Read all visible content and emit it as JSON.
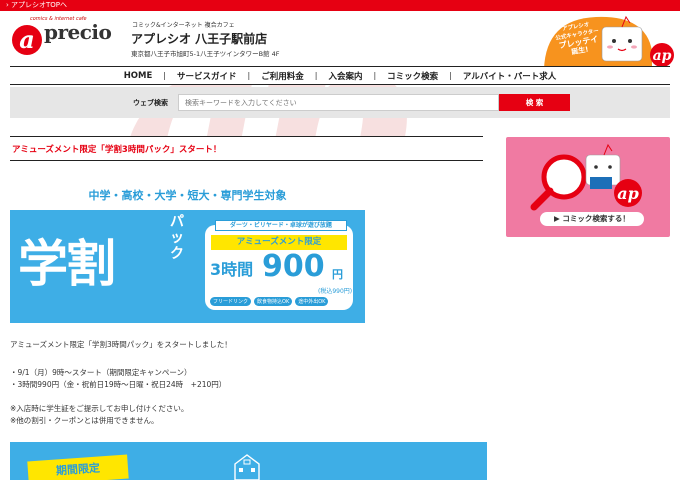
{
  "topbar": {
    "label": "› アプレシオTOPへ"
  },
  "header": {
    "logo_tagline": "comics & internet cafe",
    "logo_word": "precio",
    "store_tag": "コミック&インターネット 複合カフェ",
    "store_name": "アプレシオ 八王子駅前店",
    "store_address": "東京都八王子市旭町5-1八王子ツインタワーB館 4F",
    "mascot_caption": [
      "アプレシオ",
      "公式キャラクター",
      "プレッテイ",
      "誕生!"
    ]
  },
  "nav": {
    "items": [
      "HOME",
      "サービスガイド",
      "ご利用料金",
      "入会案内",
      "コミック検索",
      "アルバイト・パート求人"
    ],
    "separator": "|"
  },
  "search": {
    "label": "ウェブ検索",
    "placeholder": "検索キーワードを入力してください",
    "button": "検 索"
  },
  "article": {
    "title": "アミューズメント限定「学割3時間パック」スタート！",
    "banner": {
      "headline": "中学・高校・大学・短大・専門学生対象",
      "big_text": "学割",
      "pack_text": "パック",
      "strip": "ダーツ・ビリヤード・卓球が遊び放題",
      "limited": "アミューズメント限定",
      "time": "3時間",
      "price": "900",
      "yen": "円",
      "tax": "(税込990円)",
      "tags": [
        "フリードリンク",
        "飲食物持込OK",
        "途中外出OK"
      ]
    },
    "paragraphs": [
      "アミューズメント限定「学割3時間パック」をスタートしました！",
      "・9/1（月）9時〜スタート（期間限定キャンペーン）",
      "・3時間990円（金・祝前日19時〜日曜・祝日24時　+210円）",
      "※入店時に学生証をご提示してお申し付けください。",
      "※他の割引・クーポンとは併用できません。"
    ],
    "bottom_banner_label": "期間限定"
  },
  "sidebar": {
    "comic_search_button": "▶ コミック検索する！"
  },
  "colors": {
    "brand_red": "#e60012",
    "banner_blue": "#3eaee6",
    "sidebar_pink": "#f07aa2",
    "accent_yellow": "#ffe600"
  }
}
